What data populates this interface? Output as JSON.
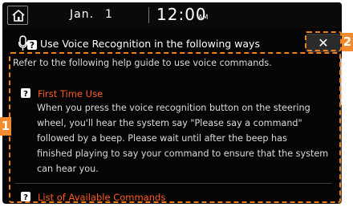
{
  "status_bar": {
    "date_month": "Jan.",
    "date_day": "1",
    "time": "12:00",
    "ampm": "AM"
  },
  "header": {
    "title": "Use Voice Recognition in the following ways",
    "close_label": "✕"
  },
  "content": {
    "intro": "Refer to the following help guide to use voice commands.",
    "sections": [
      {
        "title": "First Time Use",
        "lines": [
          "When you press the voice recognition button on the steering",
          "wheel, you'll hear the system say \"Please say a command\"",
          "followed by a beep. Please wait until after the beep has",
          "finished playing to say your command to ensure that the system",
          "can hear you."
        ]
      },
      {
        "title": "List of Available Commands",
        "lines": []
      }
    ]
  },
  "callouts": {
    "content_area": "1",
    "close_button": "2"
  },
  "colors": {
    "section_title": "#ff5a1f",
    "callout": "#f28a2e",
    "background": "#050505"
  }
}
